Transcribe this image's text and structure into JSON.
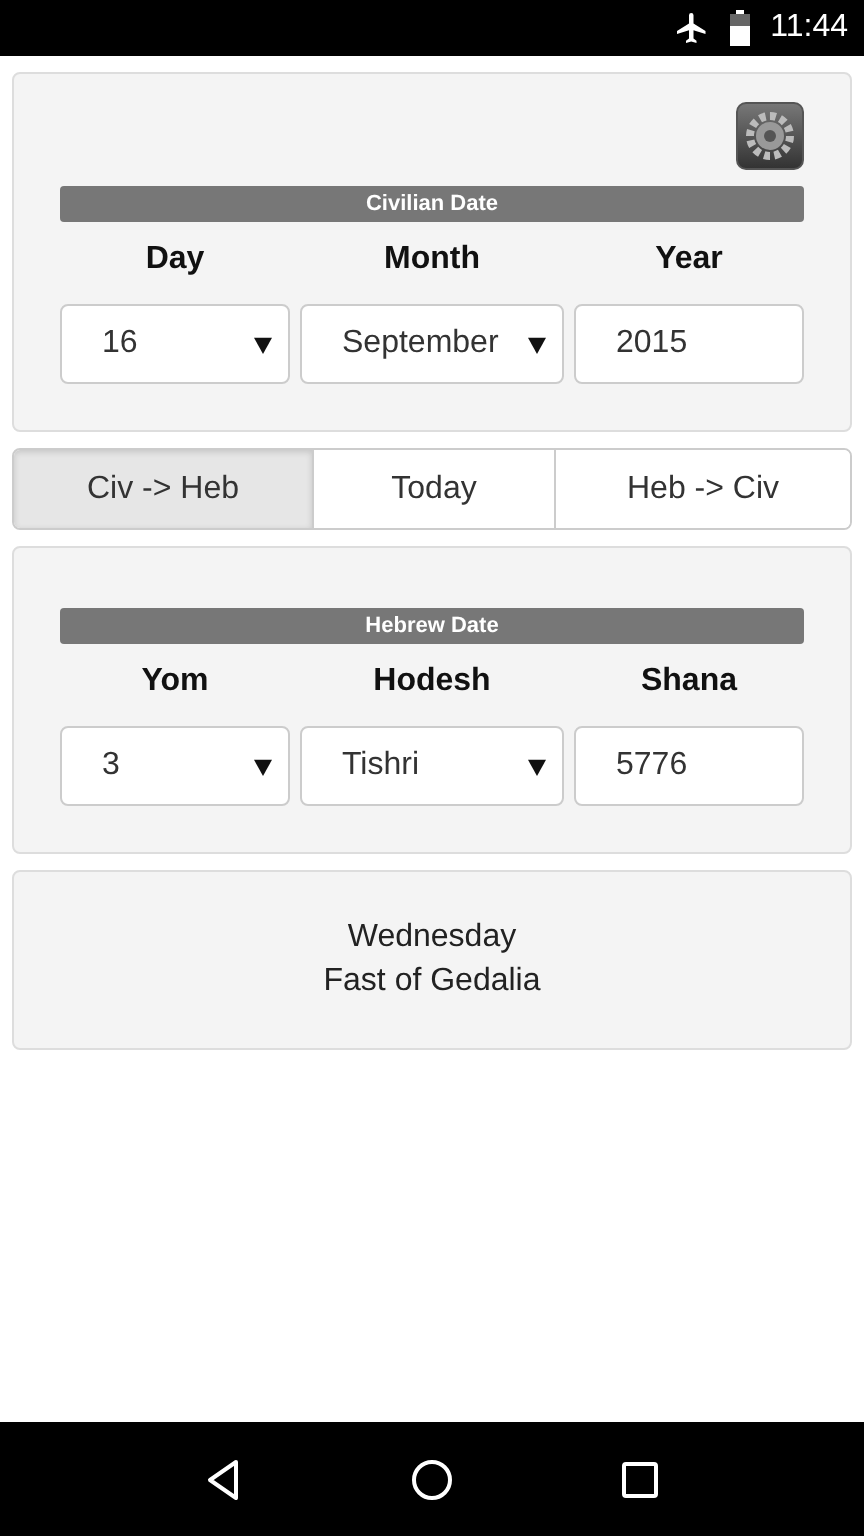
{
  "status_bar": {
    "time": "11:44"
  },
  "civilian": {
    "title": "Civilian Date",
    "fields": [
      {
        "label": "Day",
        "value": "16",
        "kind": "select"
      },
      {
        "label": "Month",
        "value": "September",
        "kind": "select"
      },
      {
        "label": "Year",
        "value": "2015",
        "kind": "input"
      }
    ]
  },
  "mode_buttons": [
    {
      "label": "Civ -> Heb",
      "selected": true
    },
    {
      "label": "Today",
      "selected": false
    },
    {
      "label": "Heb -> Civ",
      "selected": false
    }
  ],
  "hebrew": {
    "title": "Hebrew Date",
    "fields": [
      {
        "label": "Yom",
        "value": "3",
        "kind": "select"
      },
      {
        "label": "Hodesh",
        "value": "Tishri",
        "kind": "select"
      },
      {
        "label": "Shana",
        "value": "5776",
        "kind": "input"
      }
    ]
  },
  "result": {
    "lines": [
      "Wednesday",
      "Fast of Gedalia"
    ]
  }
}
